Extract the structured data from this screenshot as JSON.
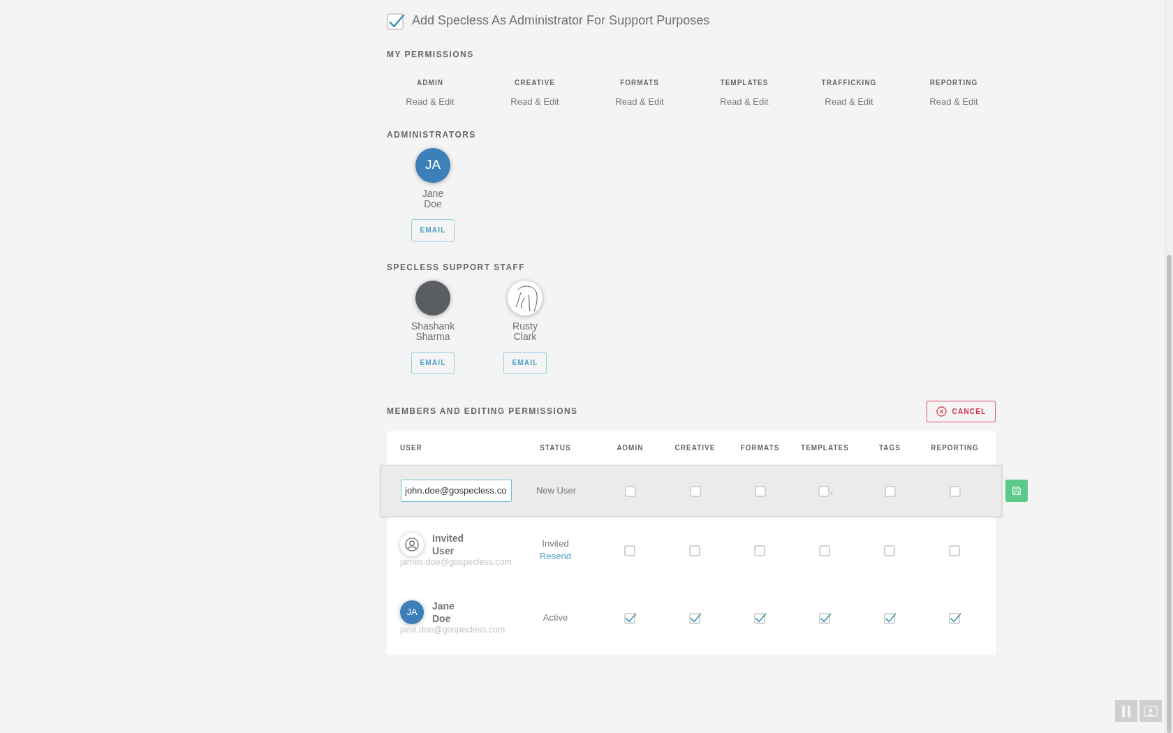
{
  "support_checkbox": {
    "label": "Add Specless As Administrator For Support Purposes",
    "checked": true
  },
  "my_permissions": {
    "title": "MY PERMISSIONS",
    "items": [
      {
        "area": "ADMIN",
        "access": "Read & Edit"
      },
      {
        "area": "CREATIVE",
        "access": "Read & Edit"
      },
      {
        "area": "FORMATS",
        "access": "Read & Edit"
      },
      {
        "area": "TEMPLATES",
        "access": "Read & Edit"
      },
      {
        "area": "TRAFFICKING",
        "access": "Read & Edit"
      },
      {
        "area": "REPORTING",
        "access": "Read & Edit"
      }
    ]
  },
  "administrators": {
    "title": "ADMINISTRATORS",
    "people": [
      {
        "name": "Jane Doe",
        "avatar": {
          "kind": "initials",
          "initials": "JA"
        },
        "button": "EMAIL"
      }
    ]
  },
  "support_staff": {
    "title": "SPECLESS SUPPORT STAFF",
    "people": [
      {
        "name": "Shashank Sharma",
        "avatar": {
          "kind": "photo"
        },
        "button": "EMAIL"
      },
      {
        "name": "Rusty Clark",
        "avatar": {
          "kind": "sketch"
        },
        "button": "EMAIL"
      }
    ]
  },
  "members": {
    "title": "MEMBERS AND EDITING PERMISSIONS",
    "cancel_button": "CANCEL",
    "columns": [
      "USER",
      "STATUS",
      "ADMIN",
      "CREATIVE",
      "FORMATS",
      "TEMPLATES",
      "TAGS",
      "REPORTING"
    ],
    "rows": [
      {
        "kind": "editing",
        "email_value": "john.doe@gospecless.co",
        "status": "New User",
        "permissions": [
          {
            "checked": false
          },
          {
            "checked": false
          },
          {
            "checked": false
          },
          {
            "checked": false,
            "suffix": ","
          },
          {
            "checked": false
          },
          {
            "checked": false
          }
        ]
      },
      {
        "kind": "member",
        "name": "Invited User",
        "email": "james.doe@gospecless.com",
        "avatar": {
          "kind": "generic"
        },
        "status": "Invited",
        "status_link": "Resend",
        "permissions": [
          {
            "checked": false
          },
          {
            "checked": false
          },
          {
            "checked": false
          },
          {
            "checked": false
          },
          {
            "checked": false
          },
          {
            "checked": false
          }
        ]
      },
      {
        "kind": "member",
        "name": "Jane Doe",
        "email": "jane.doe@gospecless.com",
        "avatar": {
          "kind": "initials",
          "initials": "JA"
        },
        "status": "Active",
        "permissions": [
          {
            "checked": true
          },
          {
            "checked": true
          },
          {
            "checked": true
          },
          {
            "checked": true
          },
          {
            "checked": true
          },
          {
            "checked": true
          }
        ]
      }
    ]
  }
}
